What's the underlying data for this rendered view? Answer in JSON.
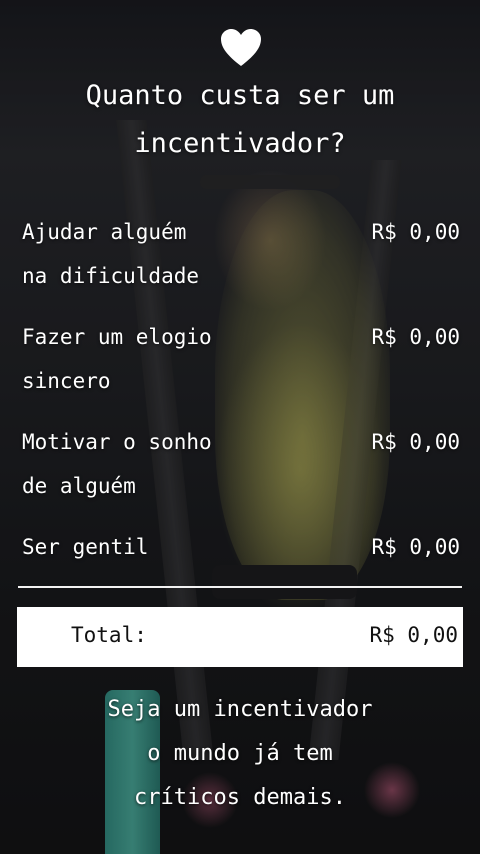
{
  "title": {
    "line1": "Quanto custa ser um",
    "line2": "incentivador?"
  },
  "items": [
    {
      "label_line1": "Ajudar alguém",
      "label_line2": "na dificuldade",
      "price": "R$ 0,00"
    },
    {
      "label_line1": "Fazer um elogio",
      "label_line2": "sincero",
      "price": "R$ 0,00"
    },
    {
      "label_line1": "Motivar o sonho",
      "label_line2": "de alguém",
      "price": "R$ 0,00"
    },
    {
      "label_line1": "Ser gentil",
      "label_line2": "",
      "price": "R$ 0,00"
    }
  ],
  "total": {
    "label": "Total:",
    "price": "R$ 0,00"
  },
  "footer": {
    "line1": "Seja um incentivador",
    "line2": "o mundo já tem",
    "line3": "críticos demais."
  },
  "icons": {
    "heart": "heart-icon"
  },
  "colors": {
    "text": "#ffffff",
    "total_bg": "#ffffff",
    "total_text": "#111111"
  }
}
